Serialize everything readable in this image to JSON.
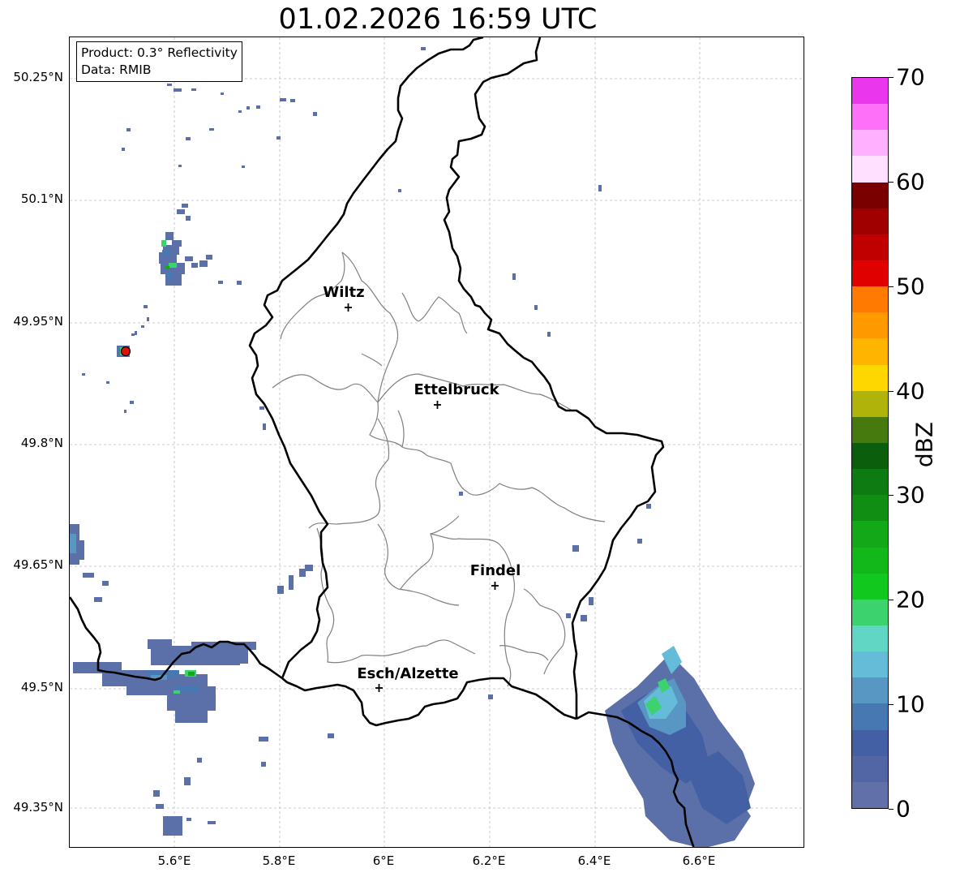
{
  "title": "01.02.2026 16:59 UTC",
  "info_box": {
    "product": "Product: 0.3° Reflectivity",
    "source": "Data: RMIB"
  },
  "axes": {
    "lat_ticks": [
      "50.25°N",
      "50.1°N",
      "49.95°N",
      "49.8°N",
      "49.65°N",
      "49.5°N",
      "49.35°N"
    ],
    "lon_ticks": [
      "5.6°E",
      "5.8°E",
      "6°E",
      "6.2°E",
      "6.4°E",
      "6.6°E"
    ]
  },
  "cities": [
    {
      "name": "Wiltz"
    },
    {
      "name": "Ettelbruck"
    },
    {
      "name": "Findel"
    },
    {
      "name": "Esch/Alzette"
    }
  ],
  "colorbar": {
    "label": "dBZ",
    "ticks": [
      "0",
      "10",
      "20",
      "30",
      "40",
      "50",
      "60",
      "70"
    ],
    "colors": [
      "#6170a8",
      "#5265a5",
      "#4460a5",
      "#4878b2",
      "#5896c4",
      "#64bcd8",
      "#62d6c4",
      "#3cd26e",
      "#10c81e",
      "#12b81a",
      "#12a818",
      "#108e14",
      "#0e7a12",
      "#0a5e0c",
      "#467a0e",
      "#b0b40a",
      "#ffd700",
      "#ffb400",
      "#ff9900",
      "#ff7a00",
      "#e00000",
      "#c00000",
      "#a00000",
      "#7a0000",
      "#ffe0ff",
      "#ffb0ff",
      "#ff70f8",
      "#ea36ec"
    ]
  },
  "colors": {
    "border": "#000000",
    "canton": "#808080",
    "grid": "#bbbbbb",
    "radar_site": "#e01010"
  }
}
